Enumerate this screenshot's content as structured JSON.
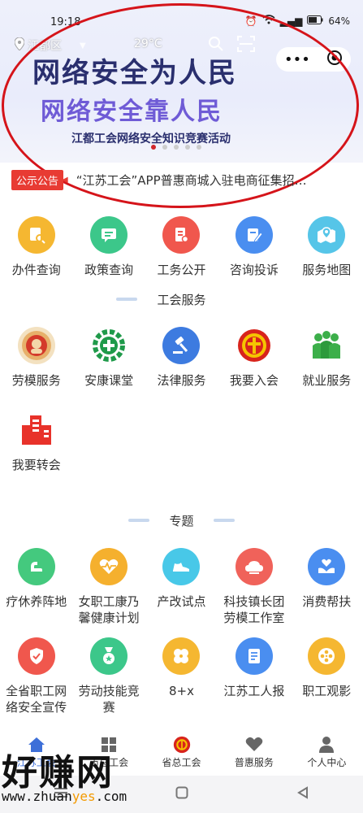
{
  "status": {
    "time": "19:18",
    "battery": "64%"
  },
  "header": {
    "location": "江都区",
    "temperature": "29°C"
  },
  "banner": {
    "headline1": "网络安全为人民",
    "headline2": "网络安全靠人民",
    "subline": "江都工会网络安全知识竞赛活动"
  },
  "notice": {
    "tag": "公示公告",
    "text": "“江苏工会”APP普惠商城入驻电商征集招…"
  },
  "top_grid": [
    {
      "label": "办件查询",
      "icon": "document-search-icon",
      "color": "#f5b731"
    },
    {
      "label": "政策查询",
      "icon": "chat-doc-icon",
      "color": "#3cc78a"
    },
    {
      "label": "工务公开",
      "icon": "doc-icon",
      "color": "#f0574d"
    },
    {
      "label": "咨询投诉",
      "icon": "edit-icon",
      "color": "#4a8ef0"
    },
    {
      "label": "服务地图",
      "icon": "map-icon",
      "color": "#56c5e8"
    }
  ],
  "service_section": {
    "title": "工会服务"
  },
  "service_grid": [
    {
      "label": "劳模服务",
      "icon": "medal-icon",
      "color": "#e7b06a"
    },
    {
      "label": "安康课堂",
      "icon": "health-gear-icon",
      "color": "#1f9a4a"
    },
    {
      "label": "法律服务",
      "icon": "gavel-icon",
      "color": "#3d7be0"
    },
    {
      "label": "我要入会",
      "icon": "union-emblem-icon",
      "color": "#d8241c"
    },
    {
      "label": "就业服务",
      "icon": "people-icon",
      "color": "#3caf4a"
    },
    {
      "label": "我要转会",
      "icon": "building-icon",
      "color": "#e8322a"
    }
  ],
  "topic_section": {
    "title": "专题"
  },
  "topic_grid": [
    {
      "label": "疗休养阵地",
      "icon": "arm-icon",
      "color": "#44c97e"
    },
    {
      "label": "女职工康乃馨健康计划",
      "icon": "heart-pulse-icon",
      "color": "#f5b02e"
    },
    {
      "label": "产改试点",
      "icon": "shoe-icon",
      "color": "#48c8e8"
    },
    {
      "label": "科技镇长团劳模工作室",
      "icon": "cloud-icon",
      "color": "#f0625a"
    },
    {
      "label": "消费帮扶",
      "icon": "hands-heart-icon",
      "color": "#4a8ef0"
    },
    {
      "label": "全省职工网络安全宣传",
      "icon": "shield-check-icon",
      "color": "#f0574d"
    },
    {
      "label": "劳动技能竞赛",
      "icon": "award-icon",
      "color": "#3cc78a"
    },
    {
      "label": "8+x",
      "icon": "clover-icon",
      "color": "#f5b731"
    },
    {
      "label": "江苏工人报",
      "icon": "newspaper-icon",
      "color": "#4a8ef0"
    },
    {
      "label": "职工观影",
      "icon": "film-reel-icon",
      "color": "#f5b731"
    }
  ],
  "tabbar": [
    {
      "label": "江苏工会",
      "icon": "home-icon"
    },
    {
      "label": "市总工会",
      "icon": "grid-icon"
    },
    {
      "label": "省总工会",
      "icon": "union-emblem-icon"
    },
    {
      "label": "普惠服务",
      "icon": "heart-icon"
    },
    {
      "label": "个人中心",
      "icon": "person-icon"
    }
  ],
  "watermark": {
    "big": "好赚网",
    "url_pre": "www.zhuan",
    "url_hl": "yes",
    "url_post": ".com"
  }
}
